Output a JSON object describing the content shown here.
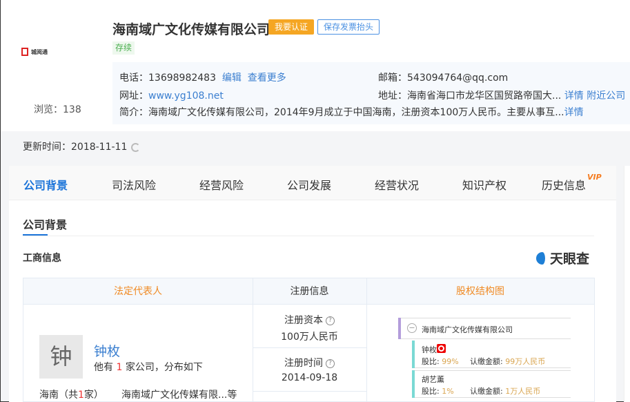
{
  "company": {
    "name": "海南域广文化传媒有限公司",
    "cert_button": "我要认证",
    "save_invoice_button": "保存发票抬头",
    "status": "存续",
    "views": "浏览：138",
    "logo_text": "城阅通"
  },
  "info": {
    "phone_label": "电话：",
    "phone": "13698982483",
    "edit": "编辑",
    "more": "查看更多",
    "email_label": "邮箱：",
    "email": "543094764@qq.com",
    "web_label": "网址：",
    "web": "www.yg108.net",
    "addr_label": "地址：",
    "addr": "海南省海口市龙华区国贸路帝国大...",
    "detail": "详情",
    "nearby": "附近公司",
    "intro_label": "简介：",
    "intro": "海南域广文化传媒有限公司，2014年9月成立于中国海南，注册资本100万人民币。主要从事互...",
    "intro_detail": "详情"
  },
  "update": {
    "label": "更新时间：2018-11-11"
  },
  "tabs": [
    "公司背景",
    "司法风险",
    "经营风险",
    "公司发展",
    "经营状况",
    "知识产权",
    "历史信息"
  ],
  "vip": "VIP",
  "section": {
    "title": "公司背景",
    "sub": "工商信息",
    "brand": "天眼查"
  },
  "table": {
    "h1": "法定代表人",
    "h2": "注册信息",
    "h3": "股权结构图",
    "avatar": "钟",
    "person": "钟枚",
    "desc_pre": "他有 ",
    "desc_count": "1",
    "desc_post": " 家公司，分布如下",
    "region_pre": "海南（共",
    "region_count": "1",
    "region_post": "家）",
    "region_companies": "海南域广文化传媒有限...等",
    "cap_label": "注册资本",
    "cap": "100万人民币",
    "date_label": "注册时间",
    "date": "2014-09-18"
  },
  "equity": {
    "company": "海南域广文化传媒有限公司",
    "holders": [
      {
        "name": "钟枚",
        "ratio_label": "股比:",
        "ratio": "99%",
        "amount_label": "认缴金额:",
        "amount": "99万人民币"
      },
      {
        "name": "胡艺薰",
        "ratio_label": "股比:",
        "ratio": "1%",
        "amount_label": "认缴金额:",
        "amount": "1万人民币"
      }
    ]
  }
}
